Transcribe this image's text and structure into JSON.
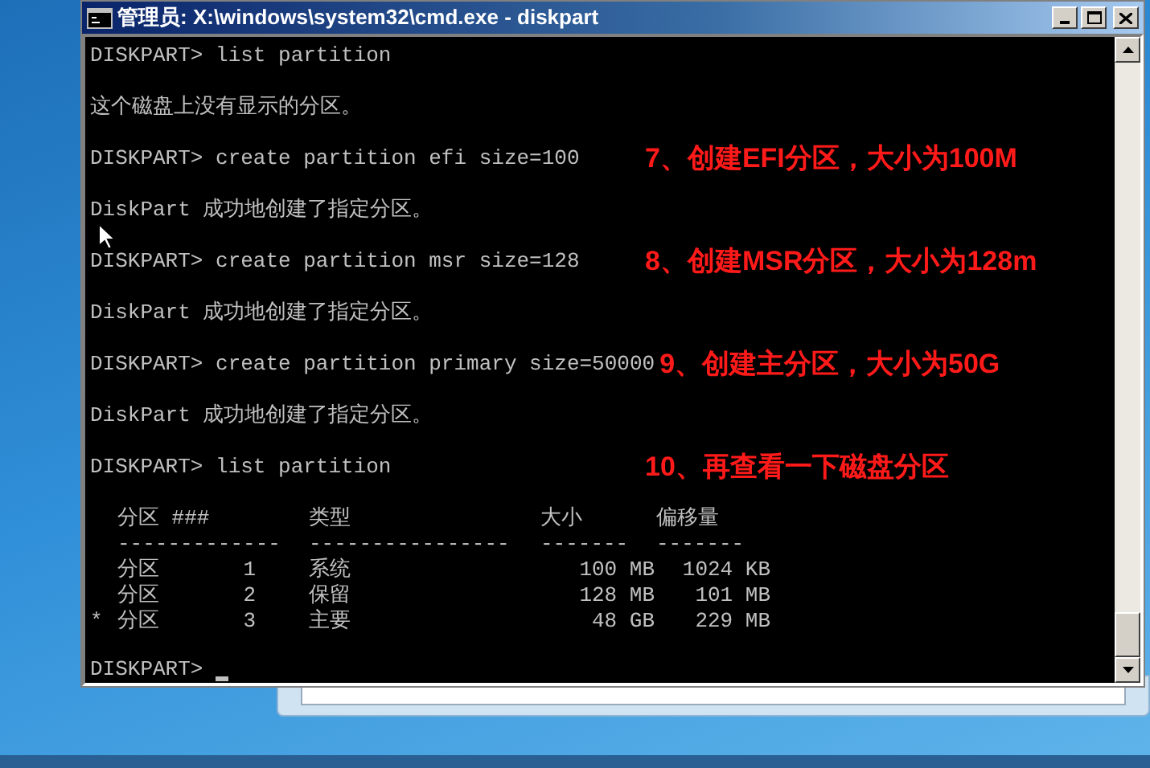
{
  "window": {
    "title": "管理员: X:\\windows\\system32\\cmd.exe - diskpart"
  },
  "console": {
    "lines": [
      {
        "text": "DISKPART> list partition"
      },
      {
        "text": "这个磁盘上没有显示的分区。"
      },
      {
        "text": "DISKPART> create partition efi size=100",
        "note": "7、创建EFI分区，大小为100M"
      },
      {
        "text": "DiskPart 成功地创建了指定分区。"
      },
      {
        "text": "DISKPART> create partition msr size=128",
        "note": "8、创建MSR分区，大小为128m"
      },
      {
        "text": "DiskPart 成功地创建了指定分区。"
      },
      {
        "text": "DISKPART> create partition primary size=50000",
        "note": "9、创建主分区，大小为50G"
      },
      {
        "text": "DiskPart 成功地创建了指定分区。"
      },
      {
        "text": "DISKPART> list partition",
        "note": "10、再查看一下磁盘分区"
      }
    ],
    "table": {
      "columns": [
        {
          "label": "分区 ###",
          "rule": "-------------"
        },
        {
          "label": "类型",
          "rule": "----------------"
        },
        {
          "label": "大小",
          "rule": "-------"
        },
        {
          "label": "偏移量",
          "rule": "-------"
        }
      ],
      "rows": [
        {
          "marker": "",
          "name": "分区",
          "number": "1",
          "type": "系统",
          "size": "100 MB",
          "offset": "1024 KB"
        },
        {
          "marker": "",
          "name": "分区",
          "number": "2",
          "type": "保留",
          "size": "128 MB",
          "offset": "101 MB"
        },
        {
          "marker": "*",
          "name": "分区",
          "number": "3",
          "type": "主要",
          "size": "48 GB",
          "offset": "229 MB"
        }
      ]
    },
    "prompt": "DISKPART>"
  }
}
